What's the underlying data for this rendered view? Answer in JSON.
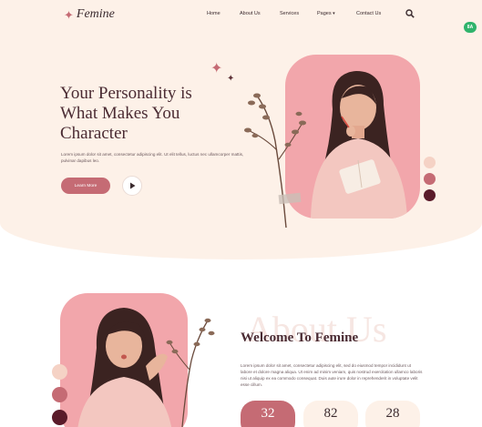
{
  "brand": {
    "name": "Femine",
    "mark_icon": "sparkle-icon",
    "accent": "#c56b74"
  },
  "nav": {
    "items": [
      {
        "label": "Home"
      },
      {
        "label": "About Us"
      },
      {
        "label": "Services"
      },
      {
        "label": "Pages"
      },
      {
        "label": "Contact Us"
      }
    ],
    "pages_icon": "chevron-down-icon",
    "search_icon": "search-icon"
  },
  "badge": {
    "text": "8A"
  },
  "hero": {
    "title_line1": "Your Personality is",
    "title_line2": "What Makes You",
    "title_line3": "Character",
    "text": "Lorem ipsum dolor sit amet, consectetur adipiscing elit. Ut elit tellus, luctus nec ullamcorper mattis, pulvinar dapibus leo.",
    "cta_label": "Learn More",
    "play_icon": "play-icon",
    "swatches": [
      "#f5d2c5",
      "#c56b74",
      "#5a1b2a"
    ]
  },
  "about": {
    "watermark": "About Us",
    "title": "Welcome To Femine",
    "text": "Lorem ipsum dolor sit amet, consectetur adipiscing elit, sed do eiusmod tempor incididunt ut labore et dolore magna aliqua. Ut enim ad minim veniam, quis nostrud exercitation ullamco laboris nisi ut aliquip ex ea commodo consequat. Duis aute irure dolor in reprehenderit in voluptate velit esse cillum.",
    "stats": [
      {
        "value": "32"
      },
      {
        "value": "82"
      },
      {
        "value": "28"
      }
    ],
    "swatches": [
      "#f5d2c5",
      "#c56b74",
      "#5a1b2a"
    ]
  }
}
